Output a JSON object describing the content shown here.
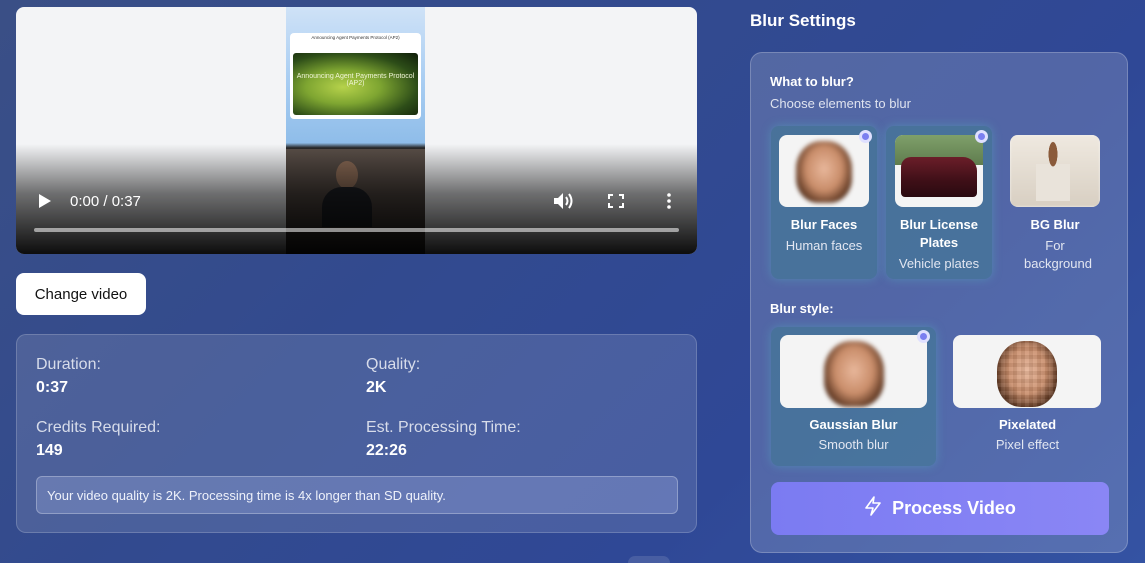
{
  "player": {
    "time": "0:00 / 0:37",
    "frame_title": "Announcing Agent Payments Protocol (AP2)",
    "frame_image_text": "Announcing Agent Payments Protocol (AP2)"
  },
  "change_video_label": "Change video",
  "info": {
    "duration_label": "Duration:",
    "duration_value": "0:37",
    "quality_label": "Quality:",
    "quality_value": "2K",
    "credits_label": "Credits Required:",
    "credits_value": "149",
    "processing_label": "Est. Processing Time:",
    "processing_value": "22:26",
    "notice": "Your video quality is 2K. Processing time is 4x longer than SD quality."
  },
  "settings": {
    "title": "Blur Settings",
    "what_title": "What to blur?",
    "what_sub": "Choose elements to blur",
    "targets": [
      {
        "name": "Blur Faces",
        "desc": "Human faces",
        "selected": true
      },
      {
        "name": "Blur License Plates",
        "desc": "Vehicle plates",
        "selected": true
      },
      {
        "name": "BG Blur",
        "desc": "For background",
        "selected": false
      }
    ],
    "style_title": "Blur style:",
    "styles": [
      {
        "name": "Gaussian Blur",
        "desc": "Smooth blur",
        "selected": true
      },
      {
        "name": "Pixelated",
        "desc": "Pixel effect",
        "selected": false
      }
    ],
    "process_label": "Process Video"
  },
  "colors": {
    "accent": "#7b7bf2",
    "selected_card": "#3c828c"
  },
  "icons": [
    "play-icon",
    "volume-icon",
    "fullscreen-icon",
    "more-vertical-icon",
    "lightning-icon"
  ]
}
